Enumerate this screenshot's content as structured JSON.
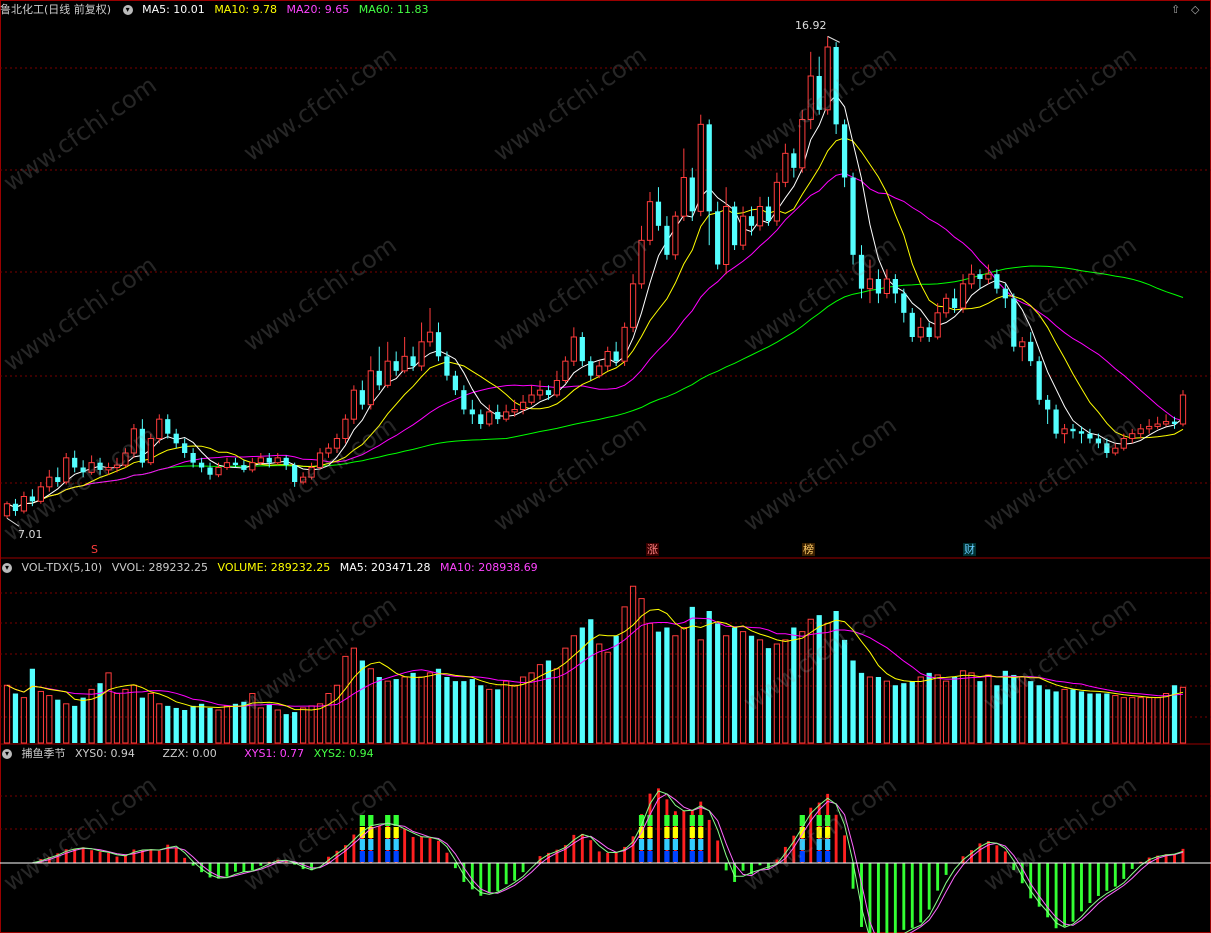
{
  "header": {
    "title": "鲁北化工(日线 前复权)",
    "ma5": "MA5: 10.01",
    "ma10": "MA10: 9.78",
    "ma20": "MA20: 9.65",
    "ma60": "MA60: 11.83"
  },
  "price_labels": {
    "high": "16.92",
    "low": "7.01"
  },
  "markers": {
    "s": "S",
    "zhang": "涨",
    "bang": "榜",
    "caibao": "财"
  },
  "volume_header": {
    "name": "VOL-TDX(5,10)",
    "vvol": "VVOL: 289232.25",
    "volume": "VOLUME: 289232.25",
    "ma5": "MA5: 203471.28",
    "ma10": "MA10: 208938.69"
  },
  "indicator_header": {
    "name": "捕鱼季节",
    "xys0": "XYS0: 0.94",
    "zzx": "ZZX: 0.00",
    "xys1": "XYS1: 0.77",
    "xys2": "XYS2: 0.94"
  },
  "watermark": "www.cfchi.com",
  "colors": {
    "up": "#ff3c3c",
    "down": "#54ffff",
    "ma5": "#ffffff",
    "ma10": "#ffff00",
    "ma20": "#ff00ff",
    "ma60": "#00ff00",
    "grid": "#7a0000",
    "frame": "#9a0000"
  },
  "chart_data": {
    "type": "candlestick",
    "price_range": [
      7.01,
      16.92
    ],
    "candles": [
      [
        7.0,
        7.25,
        7.3,
        6.95
      ],
      [
        7.25,
        7.1,
        7.35,
        7.0
      ],
      [
        7.1,
        7.4,
        7.5,
        7.05
      ],
      [
        7.4,
        7.3,
        7.55,
        7.2
      ],
      [
        7.3,
        7.6,
        7.7,
        7.25
      ],
      [
        7.6,
        7.8,
        7.95,
        7.5
      ],
      [
        7.8,
        7.7,
        8.0,
        7.6
      ],
      [
        7.7,
        8.2,
        8.3,
        7.65
      ],
      [
        8.2,
        8.0,
        8.35,
        7.9
      ],
      [
        8.0,
        7.9,
        8.15,
        7.8
      ],
      [
        7.9,
        8.1,
        8.25,
        7.85
      ],
      [
        8.1,
        7.95,
        8.2,
        7.85
      ],
      [
        7.95,
        8.0,
        8.1,
        7.85
      ],
      [
        8.0,
        8.05,
        8.2,
        7.9
      ],
      [
        8.05,
        8.3,
        8.4,
        8.0
      ],
      [
        8.3,
        8.8,
        8.9,
        8.2
      ],
      [
        8.8,
        8.1,
        9.0,
        8.0
      ],
      [
        8.1,
        8.6,
        8.7,
        8.05
      ],
      [
        8.6,
        9.0,
        9.1,
        8.5
      ],
      [
        9.0,
        8.7,
        9.1,
        8.6
      ],
      [
        8.7,
        8.5,
        8.8,
        8.4
      ],
      [
        8.5,
        8.3,
        8.6,
        8.2
      ],
      [
        8.3,
        8.1,
        8.4,
        8.0
      ],
      [
        8.1,
        8.0,
        8.2,
        7.9
      ],
      [
        8.0,
        7.85,
        8.1,
        7.75
      ],
      [
        7.85,
        8.0,
        8.1,
        7.8
      ],
      [
        8.0,
        8.1,
        8.2,
        7.95
      ],
      [
        8.1,
        8.05,
        8.2,
        8.0
      ],
      [
        8.05,
        7.95,
        8.15,
        7.9
      ],
      [
        7.95,
        8.1,
        8.2,
        7.9
      ],
      [
        8.1,
        8.2,
        8.3,
        8.05
      ],
      [
        8.2,
        8.1,
        8.3,
        8.0
      ],
      [
        8.1,
        8.2,
        8.3,
        8.05
      ],
      [
        8.2,
        8.05,
        8.25,
        7.95
      ],
      [
        8.05,
        7.7,
        8.1,
        7.6
      ],
      [
        7.7,
        7.8,
        7.9,
        7.65
      ],
      [
        7.8,
        8.0,
        8.1,
        7.75
      ],
      [
        8.0,
        8.3,
        8.4,
        7.95
      ],
      [
        8.3,
        8.4,
        8.5,
        8.2
      ],
      [
        8.4,
        8.6,
        8.7,
        8.3
      ],
      [
        8.6,
        9.0,
        9.1,
        8.5
      ],
      [
        9.0,
        9.6,
        9.7,
        8.9
      ],
      [
        9.6,
        9.3,
        9.8,
        9.2
      ],
      [
        9.3,
        10.0,
        10.3,
        9.2
      ],
      [
        10.0,
        9.7,
        10.5,
        9.6
      ],
      [
        9.7,
        10.2,
        10.6,
        9.65
      ],
      [
        10.2,
        10.0,
        10.4,
        9.9
      ],
      [
        10.0,
        10.3,
        10.7,
        9.95
      ],
      [
        10.3,
        10.1,
        10.5,
        10.0
      ],
      [
        10.1,
        10.6,
        11.0,
        10.0
      ],
      [
        10.6,
        10.8,
        11.3,
        10.5
      ],
      [
        10.8,
        10.3,
        11.0,
        10.2
      ],
      [
        10.3,
        9.9,
        10.4,
        9.8
      ],
      [
        9.9,
        9.6,
        10.0,
        9.5
      ],
      [
        9.6,
        9.2,
        9.7,
        9.1
      ],
      [
        9.2,
        9.1,
        9.4,
        8.9
      ],
      [
        9.1,
        8.9,
        9.2,
        8.8
      ],
      [
        8.9,
        9.15,
        9.3,
        8.85
      ],
      [
        9.15,
        9.0,
        9.3,
        8.9
      ],
      [
        9.0,
        9.15,
        9.3,
        8.95
      ],
      [
        9.15,
        9.2,
        9.4,
        9.05
      ],
      [
        9.2,
        9.35,
        9.5,
        9.1
      ],
      [
        9.35,
        9.5,
        9.7,
        9.3
      ],
      [
        9.5,
        9.6,
        9.8,
        9.4
      ],
      [
        9.6,
        9.5,
        9.7,
        9.4
      ],
      [
        9.5,
        9.8,
        10.0,
        9.45
      ],
      [
        9.8,
        10.2,
        10.3,
        9.75
      ],
      [
        10.2,
        10.7,
        10.9,
        10.1
      ],
      [
        10.7,
        10.2,
        10.8,
        10.1
      ],
      [
        10.2,
        9.9,
        10.3,
        9.8
      ],
      [
        9.9,
        10.1,
        10.2,
        9.85
      ],
      [
        10.1,
        10.4,
        10.5,
        10.0
      ],
      [
        10.4,
        10.2,
        10.6,
        10.1
      ],
      [
        10.2,
        10.9,
        11.0,
        10.1
      ],
      [
        10.9,
        11.8,
        12.0,
        10.8
      ],
      [
        11.8,
        12.7,
        13.0,
        11.7
      ],
      [
        12.7,
        13.5,
        13.7,
        12.6
      ],
      [
        13.5,
        13.0,
        13.8,
        12.9
      ],
      [
        13.0,
        12.4,
        13.2,
        12.3
      ],
      [
        12.4,
        13.2,
        13.3,
        12.3
      ],
      [
        13.2,
        14.0,
        14.6,
        13.1
      ],
      [
        14.0,
        13.3,
        14.2,
        13.1
      ],
      [
        13.3,
        15.1,
        15.3,
        13.2
      ],
      [
        15.1,
        13.3,
        15.2,
        12.6
      ],
      [
        13.3,
        12.2,
        13.5,
        12.1
      ],
      [
        12.2,
        13.4,
        13.8,
        12.0
      ],
      [
        13.4,
        12.6,
        13.5,
        12.5
      ],
      [
        12.6,
        13.2,
        13.4,
        12.5
      ],
      [
        13.2,
        13.0,
        13.4,
        12.8
      ],
      [
        13.0,
        13.4,
        13.6,
        12.9
      ],
      [
        13.4,
        13.1,
        13.6,
        13.0
      ],
      [
        13.1,
        13.9,
        14.1,
        13.0
      ],
      [
        13.9,
        14.5,
        14.7,
        13.8
      ],
      [
        14.5,
        14.2,
        14.6,
        14.0
      ],
      [
        14.2,
        15.2,
        15.4,
        14.1
      ],
      [
        15.2,
        16.1,
        16.6,
        15.0
      ],
      [
        16.1,
        15.4,
        16.5,
        15.3
      ],
      [
        15.4,
        16.7,
        16.92,
        15.3
      ],
      [
        16.7,
        15.1,
        16.8,
        14.9
      ],
      [
        15.1,
        14.0,
        15.2,
        13.8
      ],
      [
        14.0,
        12.4,
        14.1,
        12.2
      ],
      [
        12.4,
        11.7,
        12.6,
        11.5
      ],
      [
        11.7,
        11.9,
        12.3,
        11.4
      ],
      [
        11.9,
        11.6,
        12.1,
        11.4
      ],
      [
        11.6,
        11.9,
        12.1,
        11.5
      ],
      [
        11.9,
        11.6,
        12.0,
        11.4
      ],
      [
        11.6,
        11.2,
        11.7,
        11.0
      ],
      [
        11.2,
        10.7,
        11.3,
        10.6
      ],
      [
        10.7,
        10.9,
        11.1,
        10.6
      ],
      [
        10.9,
        10.7,
        11.0,
        10.6
      ],
      [
        10.7,
        11.2,
        11.4,
        10.65
      ],
      [
        11.2,
        11.5,
        11.6,
        11.1
      ],
      [
        11.5,
        11.3,
        11.7,
        11.2
      ],
      [
        11.3,
        11.8,
        12.0,
        11.2
      ],
      [
        11.8,
        12.0,
        12.2,
        11.7
      ],
      [
        12.0,
        11.9,
        12.1,
        11.7
      ],
      [
        11.9,
        12.0,
        12.2,
        11.8
      ],
      [
        12.0,
        11.7,
        12.1,
        11.6
      ],
      [
        11.7,
        11.5,
        11.8,
        11.3
      ],
      [
        11.5,
        10.5,
        11.6,
        10.4
      ],
      [
        10.5,
        10.6,
        10.7,
        10.2
      ],
      [
        10.6,
        10.2,
        10.8,
        10.1
      ],
      [
        10.2,
        9.4,
        10.3,
        9.3
      ],
      [
        9.4,
        9.2,
        9.5,
        8.9
      ],
      [
        9.2,
        8.7,
        9.3,
        8.6
      ],
      [
        8.7,
        8.8,
        8.9,
        8.5
      ],
      [
        8.8,
        8.75,
        8.9,
        8.6
      ],
      [
        8.75,
        8.7,
        8.85,
        8.5
      ],
      [
        8.7,
        8.6,
        8.8,
        8.5
      ],
      [
        8.6,
        8.5,
        8.7,
        8.4
      ],
      [
        8.5,
        8.3,
        8.6,
        8.2
      ],
      [
        8.3,
        8.4,
        8.5,
        8.25
      ],
      [
        8.4,
        8.6,
        8.7,
        8.35
      ],
      [
        8.6,
        8.7,
        8.8,
        8.5
      ],
      [
        8.7,
        8.8,
        8.9,
        8.6
      ],
      [
        8.8,
        8.85,
        9.0,
        8.7
      ],
      [
        8.85,
        8.9,
        9.05,
        8.8
      ],
      [
        8.9,
        8.95,
        9.1,
        8.85
      ],
      [
        8.95,
        8.9,
        9.05,
        8.8
      ],
      [
        8.9,
        9.5,
        9.6,
        8.85
      ]
    ],
    "volume": [
      140,
      120,
      110,
      180,
      125,
      115,
      105,
      95,
      90,
      110,
      130,
      145,
      170,
      120,
      130,
      140,
      110,
      120,
      95,
      90,
      85,
      80,
      90,
      95,
      85,
      80,
      90,
      95,
      100,
      120,
      85,
      95,
      80,
      70,
      75,
      85,
      90,
      95,
      120,
      140,
      210,
      230,
      200,
      180,
      160,
      150,
      155,
      160,
      170,
      160,
      170,
      180,
      160,
      150,
      150,
      155,
      140,
      130,
      130,
      150,
      140,
      160,
      170,
      190,
      200,
      180,
      230,
      260,
      280,
      300,
      240,
      220,
      260,
      330,
      380,
      350,
      290,
      270,
      280,
      260,
      280,
      330,
      250,
      320,
      290,
      260,
      280,
      270,
      260,
      250,
      230,
      240,
      250,
      280,
      270,
      300,
      310,
      290,
      320,
      250,
      200,
      170,
      160,
      160,
      150,
      140,
      145,
      150,
      160,
      170,
      165,
      150,
      160,
      175,
      170,
      150,
      165,
      140,
      175,
      165,
      160,
      150,
      140,
      130,
      125,
      130,
      130,
      125,
      120,
      120,
      120,
      115,
      110,
      110,
      110,
      110,
      110,
      120,
      140,
      135
    ],
    "indicator": {
      "zzx": 0.0,
      "xys0": 0.94,
      "xys1": 0.77,
      "xys2": 0.94
    }
  }
}
